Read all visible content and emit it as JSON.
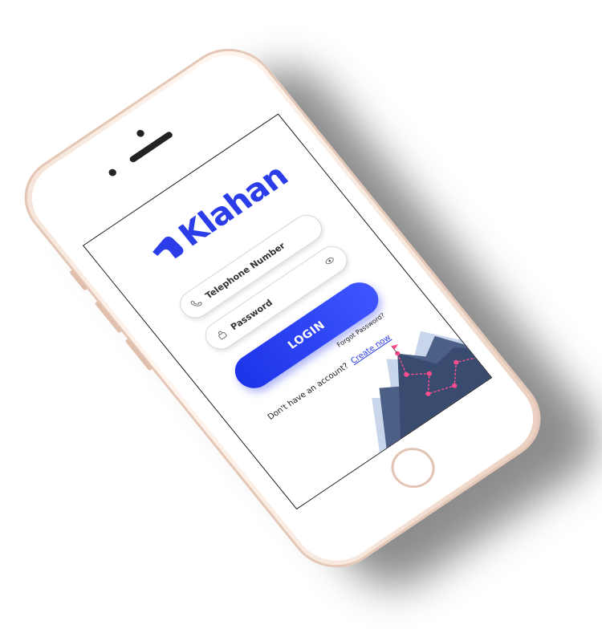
{
  "brand": {
    "name": "Klahan",
    "color": "#2a3de8"
  },
  "login_form": {
    "telephone_placeholder": "Telephone Number",
    "password_placeholder": "Password",
    "login_label": "LOGIN",
    "forgot_password": "Forgot Password?",
    "signup_prompt": "Don't have an account?",
    "signup_link": "Create now"
  },
  "icons": {
    "phone": "phone-icon",
    "lock": "lock-icon",
    "eye": "eye-icon"
  },
  "colors": {
    "accent": "#2a3de8",
    "mountain": "#4c5f86",
    "route": "#ff4d8d",
    "phone_body": "#f3e2d6"
  }
}
